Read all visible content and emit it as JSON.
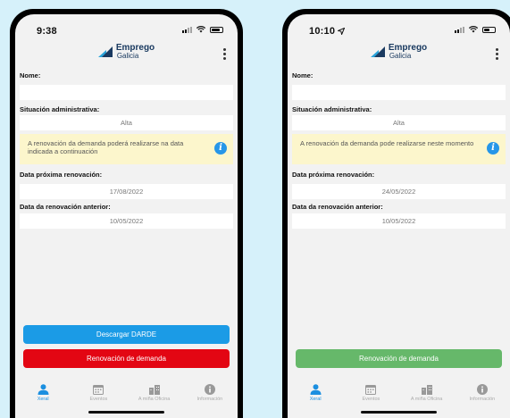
{
  "phones": [
    {
      "time": "9:38",
      "brand": {
        "title": "Emprego",
        "subtitle": "Galicia"
      },
      "fields": [
        {
          "label": "Nome:",
          "value": ""
        },
        {
          "label": "Situación administrativa:",
          "value": "Alta"
        },
        {
          "label": "Data próxima renovación:",
          "value": "17/08/2022"
        },
        {
          "label": "Data da renovación anterior:",
          "value": "10/05/2022"
        }
      ],
      "info": {
        "text": "A renovación da demanda poderá realizarse na data indicada a continuación",
        "icon": "i"
      },
      "buttons": [
        {
          "label": "Descargar DARDE",
          "color": "#1b9be6"
        },
        {
          "label": "Renovación de demanda",
          "color": "#e30613"
        }
      ],
      "tabs": [
        {
          "label": "Xeral",
          "icon": "person-icon",
          "active": true
        },
        {
          "label": "Eventos",
          "icon": "calendar-icon",
          "active": false
        },
        {
          "label": "A miña Oficina",
          "icon": "office-icon",
          "active": false
        },
        {
          "label": "Información",
          "icon": "info-icon",
          "active": false
        }
      ]
    },
    {
      "time": "10:10",
      "brand": {
        "title": "Emprego",
        "subtitle": "Galicia"
      },
      "fields": [
        {
          "label": "Nome:",
          "value": ""
        },
        {
          "label": "Situación administrativa:",
          "value": "Alta"
        },
        {
          "label": "Data próxima renovación:",
          "value": "24/05/2022"
        },
        {
          "label": "Data da renovación anterior:",
          "value": "10/05/2022"
        }
      ],
      "info": {
        "text": "A renovación da demanda pode realizarse neste momento",
        "icon": "i"
      },
      "buttons": [
        {
          "label": "Renovación de demanda",
          "color": "#66b86a"
        }
      ],
      "tabs": [
        {
          "label": "Xeral",
          "icon": "person-icon",
          "active": true
        },
        {
          "label": "Eventos",
          "icon": "calendar-icon",
          "active": false
        },
        {
          "label": "A miña Oficina",
          "icon": "office-icon",
          "active": false
        },
        {
          "label": "Información",
          "icon": "info-icon",
          "active": false
        }
      ]
    }
  ],
  "colors": {
    "accent": "#1b8fe0",
    "info_bg": "#fcf6cc",
    "page_bg": "#d6f1fa"
  }
}
